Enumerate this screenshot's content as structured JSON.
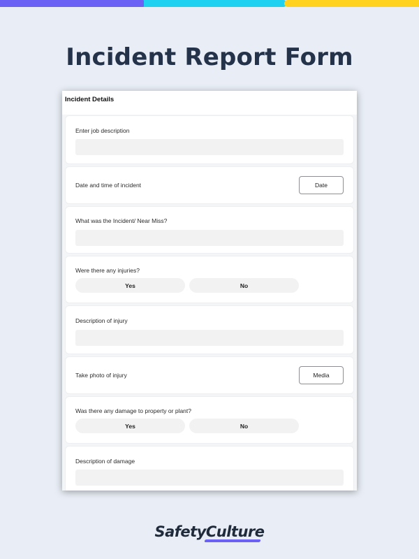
{
  "page_title": "Incident Report Form",
  "form": {
    "section_title": "Incident Details",
    "questions": [
      {
        "label": "Enter job description"
      },
      {
        "label": "Date and time of incident",
        "button": "Date"
      },
      {
        "label": "What was the Incident/ Near Miss?"
      },
      {
        "label": "Were there any injuries?",
        "yes": "Yes",
        "no": "No"
      },
      {
        "label": "Description of injury"
      },
      {
        "label": "Take photo of injury",
        "button": "Media"
      },
      {
        "label": "Was there any damage to property or plant?",
        "yes": "Yes",
        "no": "No"
      },
      {
        "label": "Description of damage"
      }
    ]
  },
  "brand": {
    "logo_text": "SafetyCulture"
  },
  "colors": {
    "background": "#e9eef6",
    "bar_purple": "#6b62f5",
    "bar_cyan": "#1fd1f0",
    "bar_yellow": "#ffd21f"
  }
}
